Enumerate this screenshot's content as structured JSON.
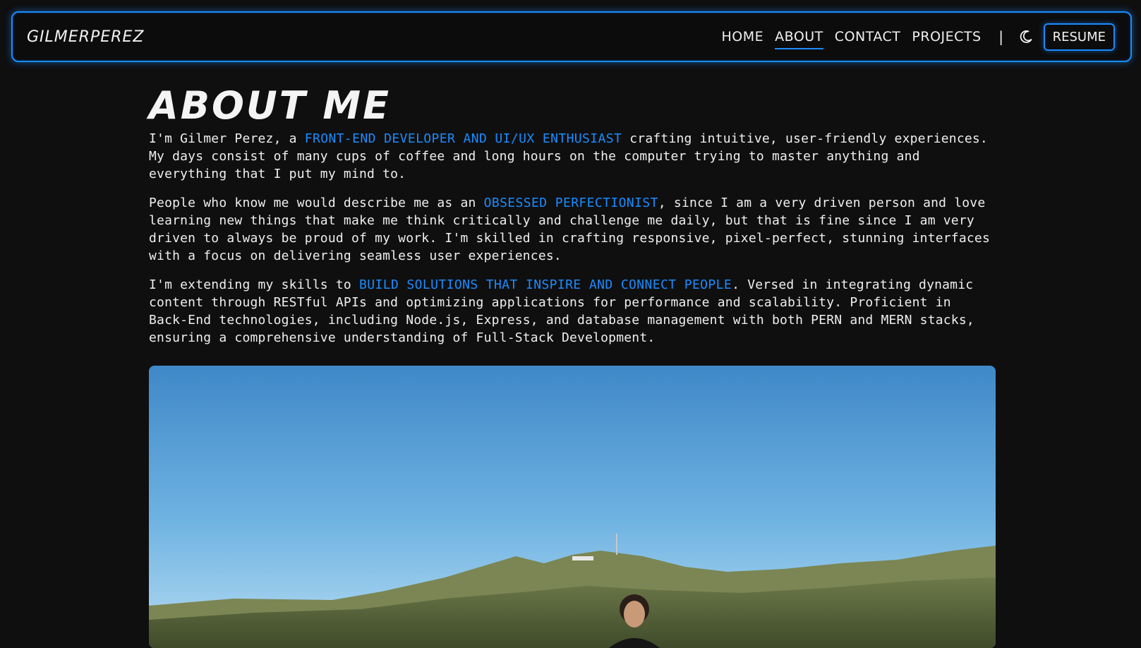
{
  "nav": {
    "brand": "GILMERPEREZ",
    "links": [
      {
        "label": "HOME"
      },
      {
        "label": "ABOUT"
      },
      {
        "label": "CONTACT"
      },
      {
        "label": "PROJECTS"
      }
    ],
    "active": "ABOUT",
    "separator": "|",
    "theme_icon": "moon-icon",
    "resume_label": "RESUME"
  },
  "about": {
    "title": "ABOUT ME",
    "p1": {
      "before": "I'm Gilmer Perez, a ",
      "highlight": "FRONT-END DEVELOPER AND UI/UX ENTHUSIAST",
      "after": " crafting intuitive, user-friendly experiences. My days consist of many cups of coffee and long hours on the computer trying to master anything and everything that I put my mind to."
    },
    "p2": {
      "before": "People who know me would describe me as an ",
      "highlight": "OBSESSED PERFECTIONIST",
      "after": ", since I am a very driven person and love learning new things that make me think critically and challenge me daily, but that is fine since I am very driven to always be proud of my work. I'm skilled in crafting responsive, pixel-perfect, stunning interfaces with a focus on delivering seamless user experiences."
    },
    "p3": {
      "before": "I'm extending my skills to ",
      "highlight": "BUILD SOLUTIONS THAT INSPIRE AND CONNECT PEOPLE",
      "after": ". Versed in integrating dynamic content through RESTful APIs and optimizing applications for performance and scalability. Proficient in Back-End technologies, including Node.js, Express, and database management with both PERN and MERN stacks, ensuring a comprehensive understanding of Full-Stack Development."
    }
  },
  "colors": {
    "accent": "#1a8cff",
    "background": "#0f0f10",
    "text": "#f2f2f2"
  }
}
